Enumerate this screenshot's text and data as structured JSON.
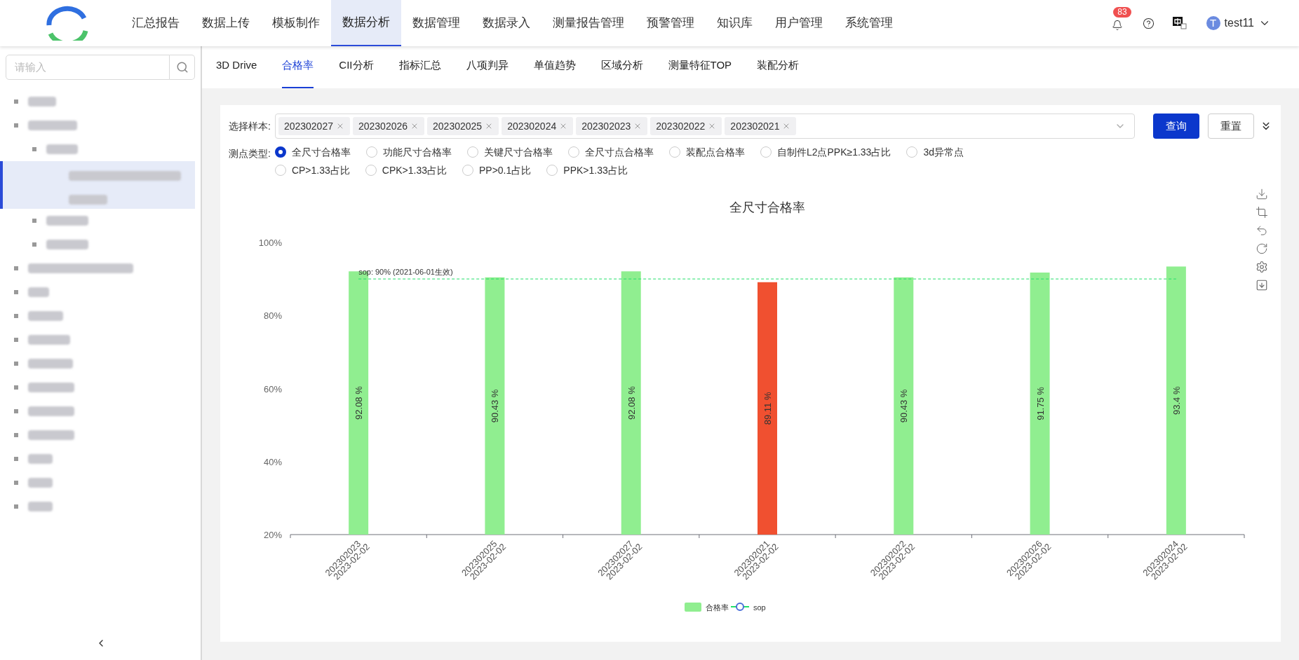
{
  "nav": [
    {
      "label": "汇总报告",
      "selected": false
    },
    {
      "label": "数据上传",
      "selected": false
    },
    {
      "label": "模板制作",
      "selected": false
    },
    {
      "label": "数据分析",
      "selected": true
    },
    {
      "label": "数据管理",
      "selected": false
    },
    {
      "label": "数据录入",
      "selected": false
    },
    {
      "label": "测量报告管理",
      "selected": false
    },
    {
      "label": "预警管理",
      "selected": false
    },
    {
      "label": "知识库",
      "selected": false
    },
    {
      "label": "用户管理",
      "selected": false
    },
    {
      "label": "系统管理",
      "selected": false
    }
  ],
  "header": {
    "notifications": "83",
    "avatar": "T",
    "user": "test11"
  },
  "sidebar": {
    "search": {
      "placeholder": "请输入"
    },
    "tree": [
      {
        "kind": "redacted",
        "selected": false
      },
      {
        "kind": "redacted",
        "selected": false,
        "children": [
          {
            "kind": "redacted",
            "selected": false,
            "children": [
              {
                "kind": "redacted",
                "selected": true
              }
            ]
          },
          {
            "kind": "redacted",
            "selected": false
          },
          {
            "kind": "redacted",
            "selected": false
          }
        ]
      },
      {
        "kind": "redacted",
        "selected": false
      },
      {
        "kind": "redacted",
        "selected": false
      },
      {
        "kind": "redacted",
        "selected": false
      },
      {
        "kind": "redacted",
        "selected": false
      },
      {
        "kind": "redacted",
        "selected": false
      },
      {
        "kind": "redacted",
        "selected": false
      },
      {
        "kind": "redacted",
        "selected": false
      },
      {
        "kind": "redacted",
        "selected": false
      },
      {
        "kind": "redacted",
        "selected": false
      },
      {
        "kind": "redacted",
        "selected": false
      },
      {
        "kind": "redacted",
        "selected": false
      }
    ]
  },
  "tabs": [
    {
      "label": "3D Drive",
      "selected": false
    },
    {
      "label": "合格率",
      "selected": true
    },
    {
      "label": "CII分析",
      "selected": false
    },
    {
      "label": "指标汇总",
      "selected": false
    },
    {
      "label": "八项判异",
      "selected": false
    },
    {
      "label": "单值趋势",
      "selected": false
    },
    {
      "label": "区域分析",
      "selected": false
    },
    {
      "label": "测量特征TOP",
      "selected": false
    },
    {
      "label": "装配分析",
      "selected": false
    }
  ],
  "filters": {
    "sample_label": "选择样本:",
    "samples": [
      "202302027",
      "202302026",
      "202302025",
      "202302024",
      "202302023",
      "202302022",
      "202302021"
    ],
    "query_button": "查询",
    "reset_button": "重置",
    "type_label": "测点类型:",
    "types": [
      {
        "label": "全尺寸合格率",
        "selected": true
      },
      {
        "label": "功能尺寸合格率",
        "selected": false
      },
      {
        "label": "关键尺寸合格率",
        "selected": false
      },
      {
        "label": "全尺寸点合格率",
        "selected": false
      },
      {
        "label": "装配点合格率",
        "selected": false
      },
      {
        "label": "自制件L2点PPK≥1.33占比",
        "selected": false
      },
      {
        "label": "3d异常点",
        "selected": false
      },
      {
        "label": "CP>1.33占比",
        "selected": false
      },
      {
        "label": "CPK>1.33占比",
        "selected": false
      },
      {
        "label": "PP>0.1占比",
        "selected": false
      },
      {
        "label": "PPK>1.33占比",
        "selected": false
      }
    ]
  },
  "chart_data": {
    "type": "bar",
    "title": "全尺寸合格率",
    "categories": [
      "202302023\n2023-02-02",
      "202302025\n2023-02-02",
      "202302027\n2023-02-02",
      "202302021\n2023-02-02",
      "202302022\n2023-02-02",
      "202302026\n2023-02-02",
      "202302024\n2023-02-02"
    ],
    "ylim": [
      20,
      100
    ],
    "yticks": [
      {
        "value": 20,
        "label": "20%"
      },
      {
        "value": 40,
        "label": "40%"
      },
      {
        "value": 60,
        "label": "60%"
      },
      {
        "value": 80,
        "label": "80%"
      },
      {
        "value": 100,
        "label": "100%"
      }
    ],
    "series": [
      {
        "name": "合格率",
        "color": "#90ee90",
        "values": [
          92.08,
          90.43,
          92.08,
          null,
          90.43,
          91.75,
          93.4
        ],
        "value_labels": [
          "92.08 %",
          "90.43 %",
          "92.08 %",
          null,
          "90.43 %",
          "91.75 %",
          "93.4 %"
        ]
      },
      {
        "color": "#f05030",
        "values": [
          null,
          null,
          null,
          89.11,
          null,
          null,
          null
        ],
        "value_labels": [
          null,
          null,
          null,
          "89.11 %",
          null,
          null,
          null
        ]
      },
      {
        "name": "sop",
        "type": "line",
        "color": "#22e06a",
        "line_style": "dashed",
        "values": [
          90,
          90,
          90,
          90,
          90,
          90,
          90
        ],
        "value_labels": [
          null,
          null,
          null,
          null,
          null,
          null,
          null
        ]
      }
    ],
    "data_labels": "value_labels",
    "legend": true,
    "annotations": [
      {
        "text": "sop: 90% (2021-06-01生效)",
        "y": 90
      }
    ]
  }
}
